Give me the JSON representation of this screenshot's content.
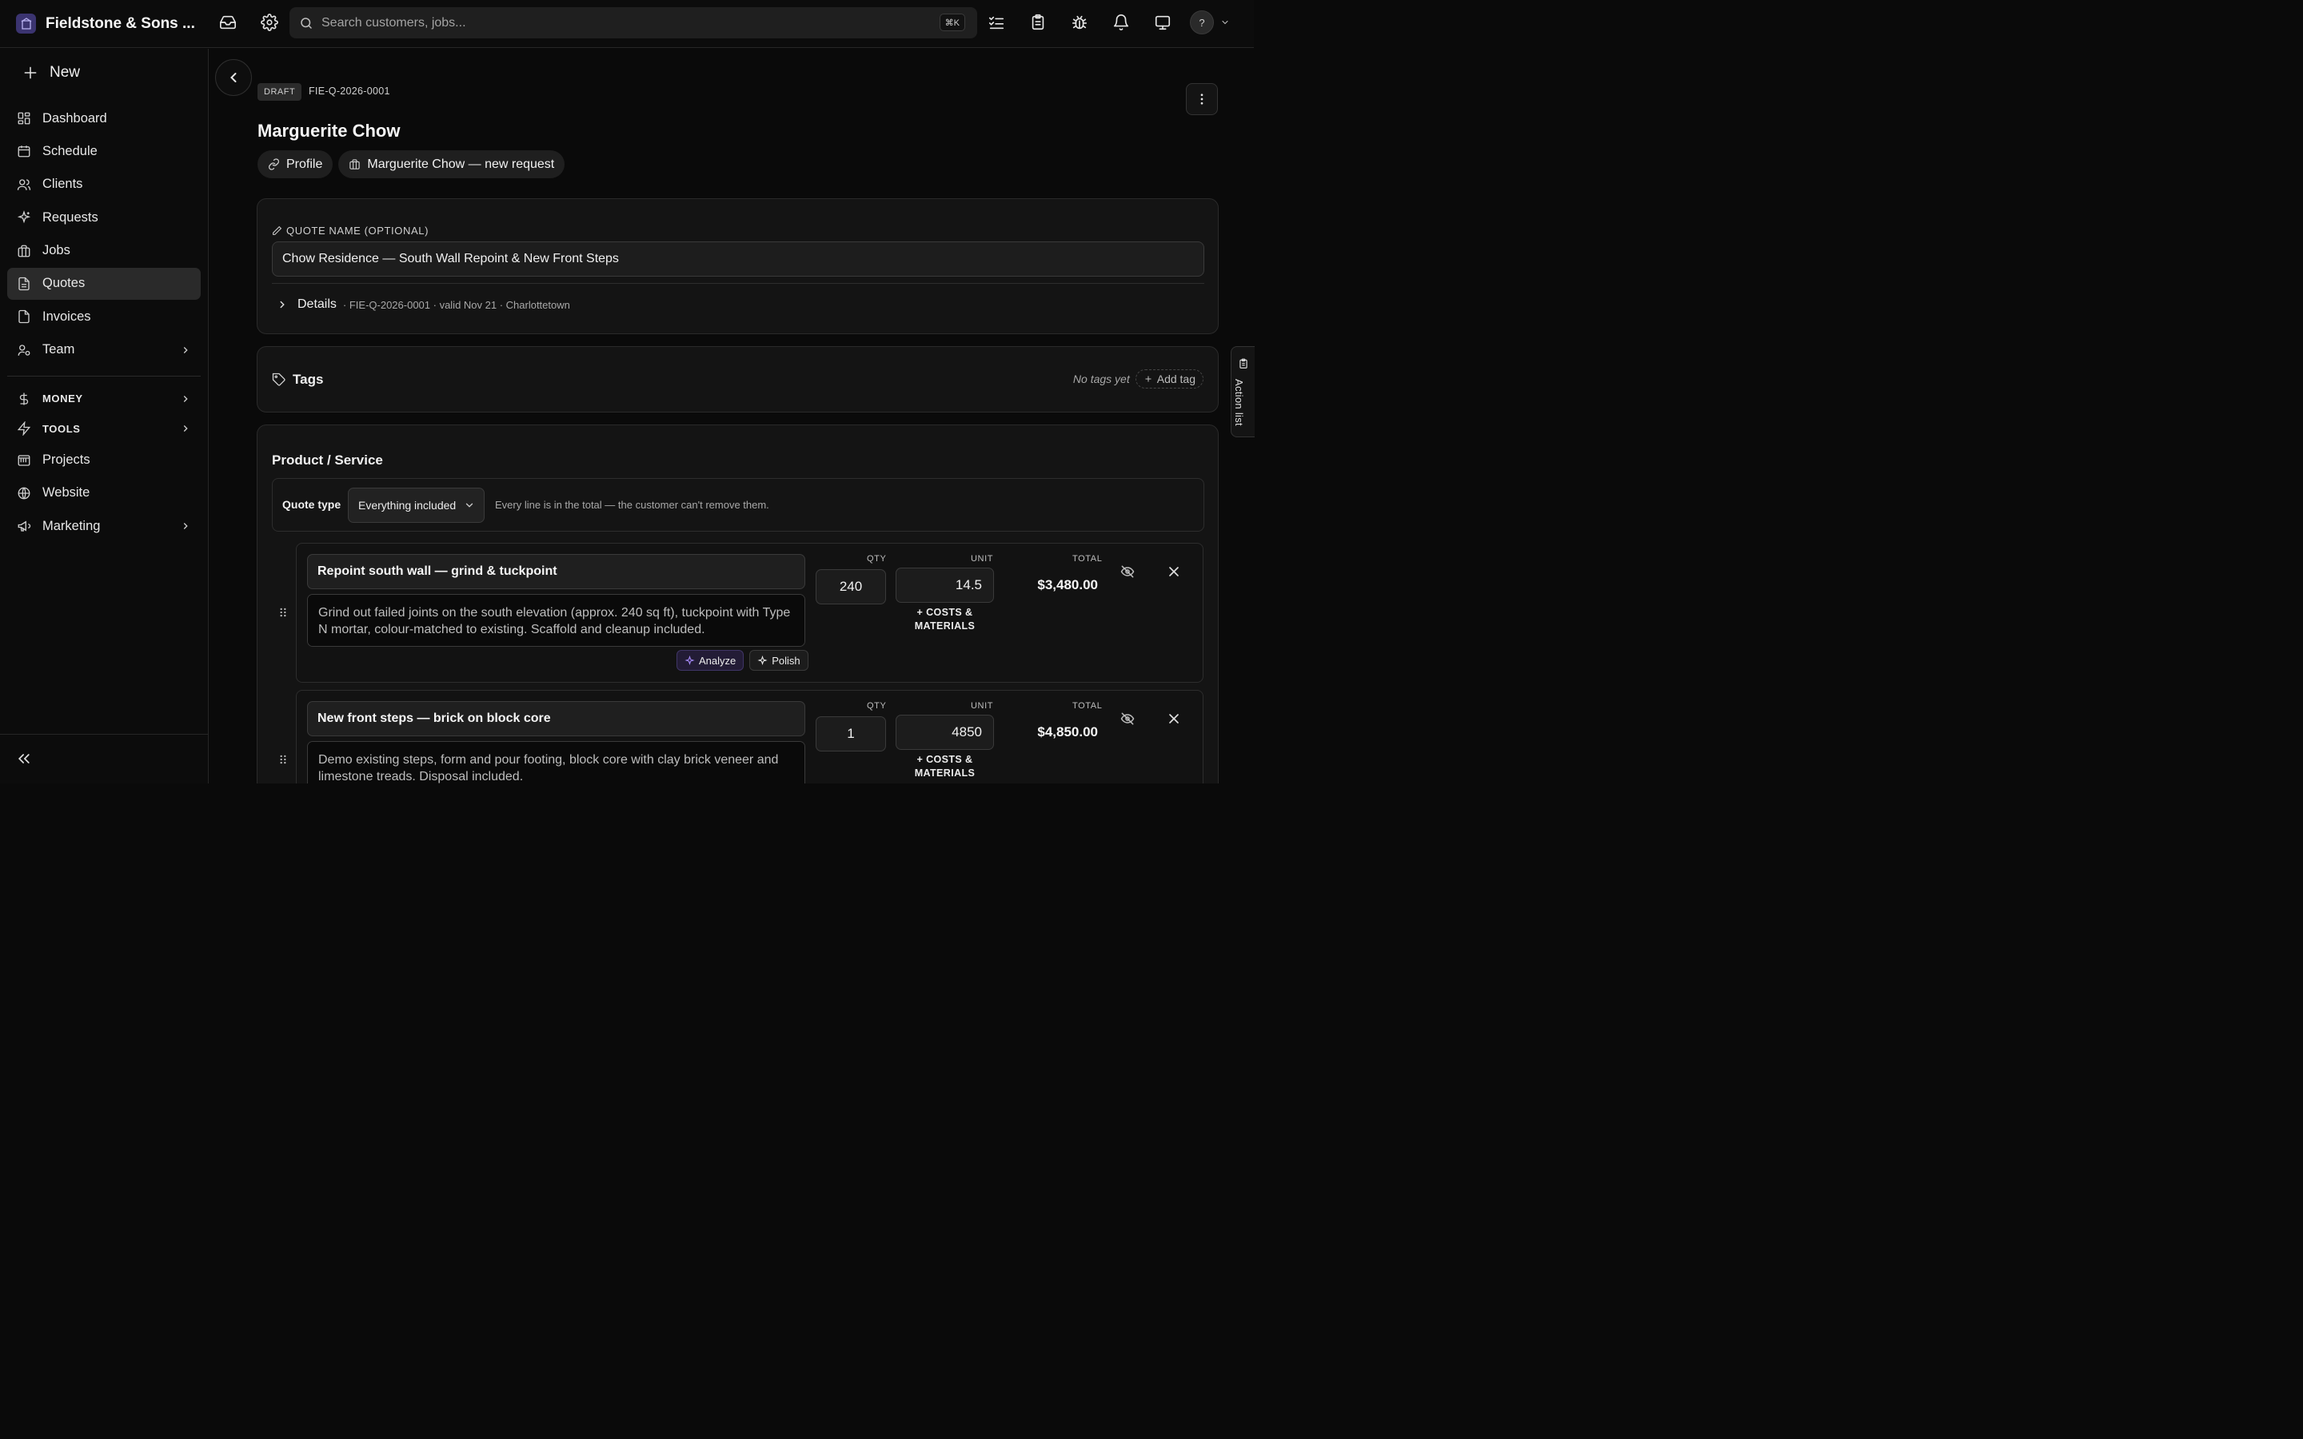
{
  "app": {
    "brand_name": "Fieldstone & Sons ...",
    "search_placeholder": "Search customers, jobs...",
    "search_shortcut": "⌘K",
    "avatar_label": "?"
  },
  "sidebar": {
    "new_label": "New",
    "items": [
      {
        "label": "Dashboard",
        "icon": "dashboard-icon"
      },
      {
        "label": "Schedule",
        "icon": "calendar-icon"
      },
      {
        "label": "Clients",
        "icon": "users-icon"
      },
      {
        "label": "Requests",
        "icon": "sparkle-icon"
      },
      {
        "label": "Jobs",
        "icon": "briefcase-icon"
      },
      {
        "label": "Quotes",
        "icon": "document-icon",
        "active": true
      },
      {
        "label": "Invoices",
        "icon": "invoice-icon"
      },
      {
        "label": "Team",
        "icon": "team-icon"
      }
    ],
    "groups": [
      {
        "label": "MONEY",
        "icon": "dollar-icon"
      },
      {
        "label": "TOOLS",
        "icon": "bolt-icon"
      }
    ],
    "items2": [
      {
        "label": "Projects",
        "icon": "projects-icon"
      },
      {
        "label": "Website",
        "icon": "globe-icon"
      },
      {
        "label": "Marketing",
        "icon": "megaphone-icon"
      }
    ]
  },
  "quote": {
    "status": "DRAFT",
    "number": "FIE-Q-2026-0001",
    "client_name": "Marguerite Chow",
    "chips": {
      "profile": "Profile",
      "request": "Marguerite Chow — new request"
    },
    "name_label": "QUOTE NAME (OPTIONAL)",
    "name_value": "Chow Residence — South Wall Repoint & New Front Steps",
    "details_label": "Details",
    "details_meta": "· FIE-Q-2026-0001 · valid Nov 21 · Charlottetown"
  },
  "tags": {
    "title": "Tags",
    "empty": "No tags yet",
    "add_label": "Add tag"
  },
  "products": {
    "title": "Product / Service",
    "quote_type_label": "Quote type",
    "quote_type_value": "Everything included",
    "quote_type_hint": "Every line is in the total — the customer can't remove them.",
    "col_qty": "QTY",
    "col_unit": "UNIT",
    "col_total": "TOTAL",
    "costs_label": "+ COSTS & MATERIALS",
    "analyze_label": "Analyze",
    "polish_label": "Polish",
    "lines": [
      {
        "name": "Repoint south wall — grind & tuckpoint",
        "description": "Grind out failed joints on the south elevation (approx. 240 sq ft), tuckpoint with Type N mortar, colour-matched to existing. Scaffold and cleanup included.",
        "qty": "240",
        "unit": "14.5",
        "total": "$3,480.00"
      },
      {
        "name": "New front steps — brick on block core",
        "description": "Demo existing steps, form and pour footing, block core with clay brick veneer and limestone treads. Disposal included.",
        "qty": "1",
        "unit": "4850",
        "total": "$4,850.00"
      }
    ]
  },
  "action_list": {
    "label": "Action list"
  }
}
